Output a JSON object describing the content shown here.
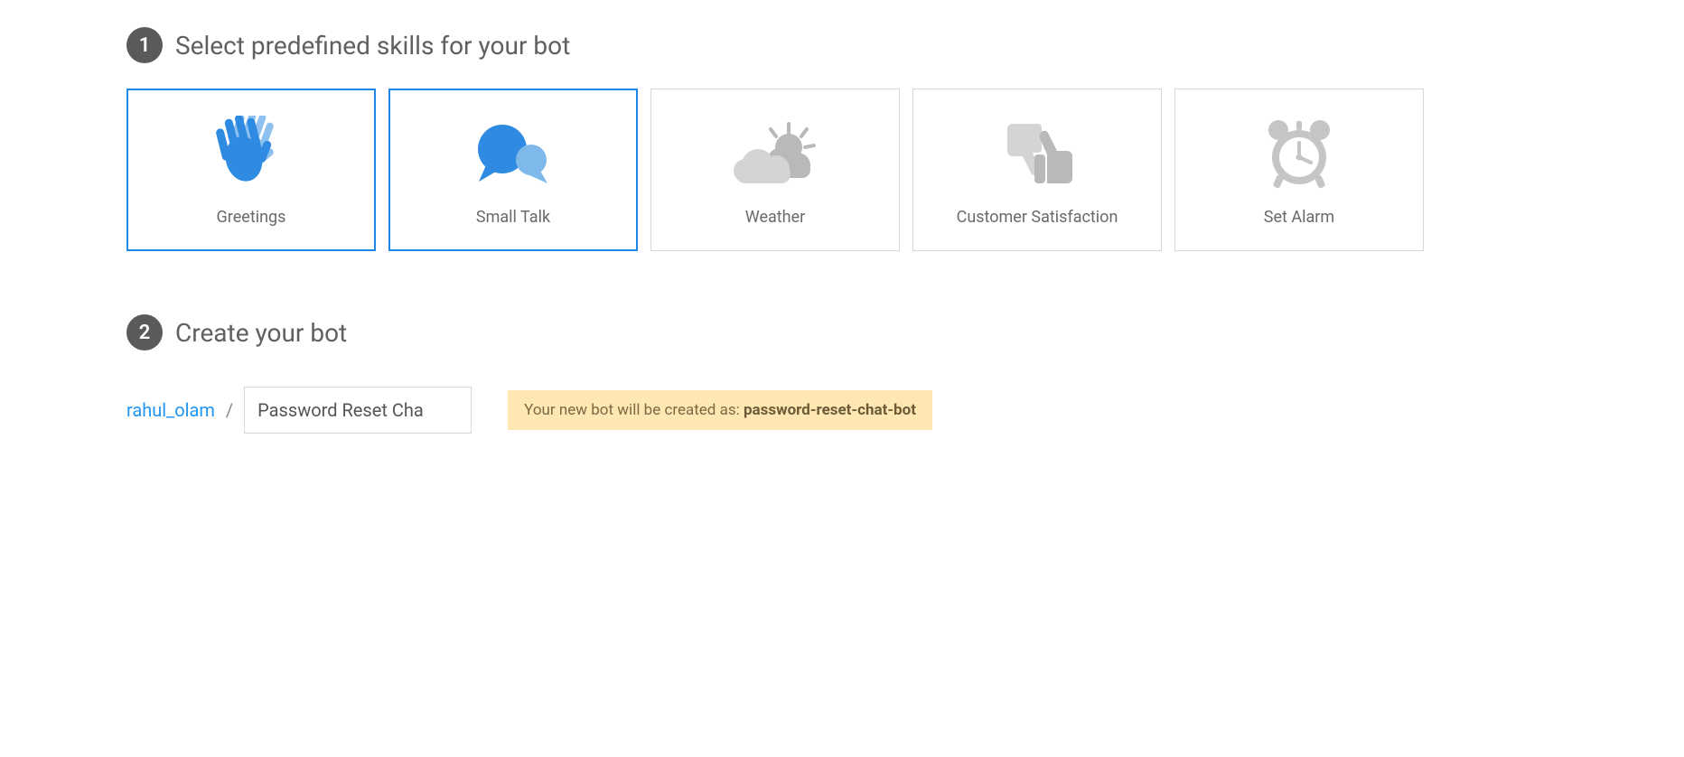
{
  "steps": {
    "one": {
      "num": "1",
      "title": "Select predefined skills for your bot"
    },
    "two": {
      "num": "2",
      "title": "Create your bot"
    }
  },
  "skills": [
    {
      "label": "Greetings",
      "selected": true,
      "icon": "hands"
    },
    {
      "label": "Small Talk",
      "selected": true,
      "icon": "chat"
    },
    {
      "label": "Weather",
      "selected": false,
      "icon": "weather"
    },
    {
      "label": "Customer Satisfaction",
      "selected": false,
      "icon": "thumbs"
    },
    {
      "label": "Set Alarm",
      "selected": false,
      "icon": "alarm"
    }
  ],
  "create": {
    "username": "rahul_olam",
    "separator": "/",
    "input_value": "Password Reset Cha",
    "notice_prefix": "Your new bot will be created as: ",
    "notice_slug": "password-reset-chat-bot"
  }
}
